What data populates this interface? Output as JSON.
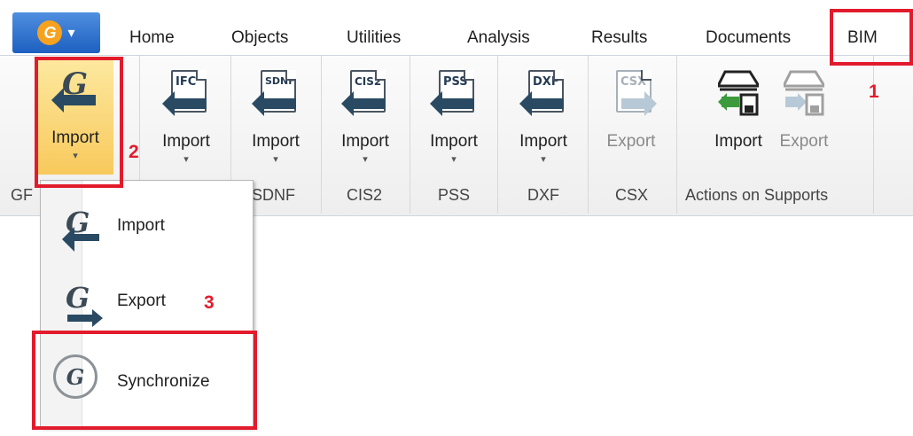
{
  "app_menu": {
    "logo_letter": "G",
    "caret": "▾"
  },
  "tabs": [
    "Home",
    "Objects",
    "Utilities",
    "Analysis",
    "Results",
    "Documents",
    "BIM"
  ],
  "ribbon": {
    "gf_button": {
      "label": "Import",
      "caret": "▾"
    },
    "buttons": [
      {
        "icon_text": "IFC",
        "label": "Import",
        "caret": "▾"
      },
      {
        "icon_text": "SDNF",
        "label": "Import",
        "caret": "▾"
      },
      {
        "icon_text": "CIS2",
        "label": "Import",
        "caret": "▾"
      },
      {
        "icon_text": "PSS",
        "label": "Import",
        "caret": "▾"
      },
      {
        "icon_text": "DXF",
        "label": "Import",
        "caret": "▾"
      },
      {
        "icon_text": "CSX",
        "label": "Export"
      }
    ],
    "supports": {
      "import_label": "Import",
      "export_label": "Export"
    },
    "group_labels": [
      "GF",
      "SDNF",
      "CIS2",
      "PSS",
      "DXF",
      "CSX",
      "Actions on Supports"
    ]
  },
  "dropdown": {
    "items": [
      {
        "label": "Import"
      },
      {
        "label": "Export"
      },
      {
        "label": "Synchronize"
      }
    ]
  },
  "annotations": {
    "n1": "1",
    "n2": "2",
    "n3": "3"
  },
  "colors": {
    "highlight": "#e21b2c",
    "app_button": "#1d5fc0",
    "logo": "#f6a21e"
  }
}
